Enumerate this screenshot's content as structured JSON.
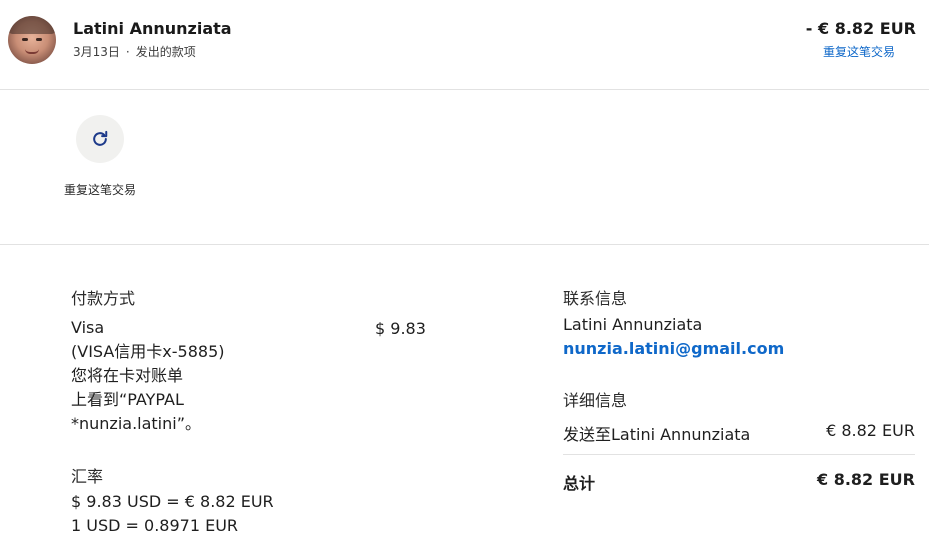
{
  "header": {
    "name": "Latini Annunziata",
    "date": "3月13日",
    "separator": "·",
    "type": "发出的款项",
    "amount": "- € 8.82 EUR",
    "repeat_link": "重复这笔交易"
  },
  "actions": {
    "repeat_label": "重复这笔交易"
  },
  "payment": {
    "title": "付款方式",
    "method": "Visa",
    "card": "(VISA信用卡x-5885)",
    "note_line1": "您将在卡对账单",
    "note_line2": "上看到“PAYPAL",
    "note_line3": "*nunzia.latini”。",
    "amount": "$ 9.83"
  },
  "exchange": {
    "title": "汇率",
    "line1": "$ 9.83 USD = € 8.82 EUR",
    "line2": "1 USD = 0.8971 EUR"
  },
  "contact": {
    "title": "联系信息",
    "name": "Latini Annunziata",
    "email": "nunzia.latini@gmail.com"
  },
  "details": {
    "title": "详细信息",
    "sent_label": "发送至Latini Annunziata",
    "sent_amount": "€ 8.82 EUR",
    "total_label": "总计",
    "total_amount": "€ 8.82 EUR"
  },
  "colors": {
    "link": "#0f68c9",
    "divider": "#e2e2e2",
    "icon": "#1d3a8a"
  }
}
